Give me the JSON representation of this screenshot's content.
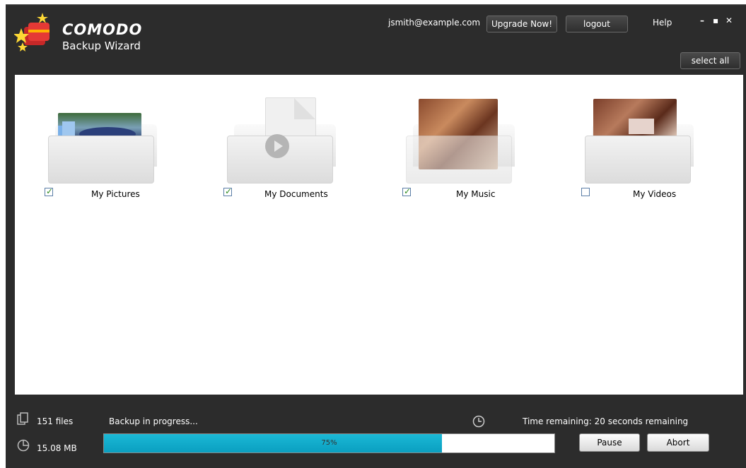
{
  "app": {
    "brand": "COMODO",
    "subtitle": "Backup Wizard"
  },
  "header": {
    "email": "jsmith@example.com",
    "upgrade_label": "Upgrade Now!",
    "logout_label": "logout",
    "help_label": "Help",
    "minimize_glyph": "–",
    "maximize_glyph": "▪",
    "close_glyph": "✕",
    "select_all_label": "select all"
  },
  "folders": [
    {
      "label": "My Pictures",
      "checked": true,
      "icon": "pictures-folder-icon"
    },
    {
      "label": "My Documents",
      "checked": true,
      "icon": "documents-folder-icon"
    },
    {
      "label": "My Music",
      "checked": true,
      "icon": "music-folder-icon"
    },
    {
      "label": "My Videos",
      "checked": false,
      "icon": "videos-folder-icon"
    }
  ],
  "footer": {
    "files": "151 files",
    "size": "15.08 MB",
    "status": "Backup in progress...",
    "time_remaining": "Time remaining: 20 seconds remaining",
    "progress_fraction": 0.75,
    "progress_label": "75%",
    "pause_label": "Pause",
    "abort_label": "Abort"
  },
  "colors": {
    "background": "#2c2c2c",
    "progress_fill": "#0aa8c8"
  }
}
